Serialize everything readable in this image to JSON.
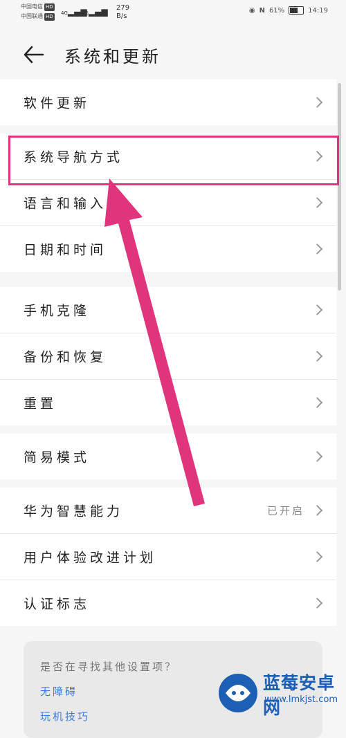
{
  "status_bar": {
    "carrier1": "中国电信",
    "carrier2": "中国联通",
    "hd": "HD",
    "net1": "4G",
    "net2": "4G",
    "speed_value": "279",
    "speed_unit": "B/s",
    "battery": "61%",
    "time": "14:19"
  },
  "header": {
    "title": "系统和更新"
  },
  "groups": [
    {
      "rows": [
        {
          "label": "软件更新"
        }
      ]
    },
    {
      "rows": [
        {
          "label": "系统导航方式"
        },
        {
          "label": "语言和输入法"
        },
        {
          "label": "日期和时间"
        }
      ]
    },
    {
      "rows": [
        {
          "label": "手机克隆"
        },
        {
          "label": "备份和恢复"
        },
        {
          "label": "重置"
        }
      ]
    },
    {
      "rows": [
        {
          "label": "简易模式"
        }
      ]
    },
    {
      "rows": [
        {
          "label": "华为智慧能力",
          "value": "已开启"
        },
        {
          "label": "用户体验改进计划"
        },
        {
          "label": "认证标志"
        }
      ]
    }
  ],
  "suggest": {
    "question": "是否在寻找其他设置项？",
    "link1": "无障碍",
    "link2": "玩机技巧"
  },
  "watermark": {
    "title": "蓝莓安卓网",
    "url": "www.lmkjst.com"
  },
  "colors": {
    "highlight": "#e0347c",
    "link": "#3b7de0"
  }
}
